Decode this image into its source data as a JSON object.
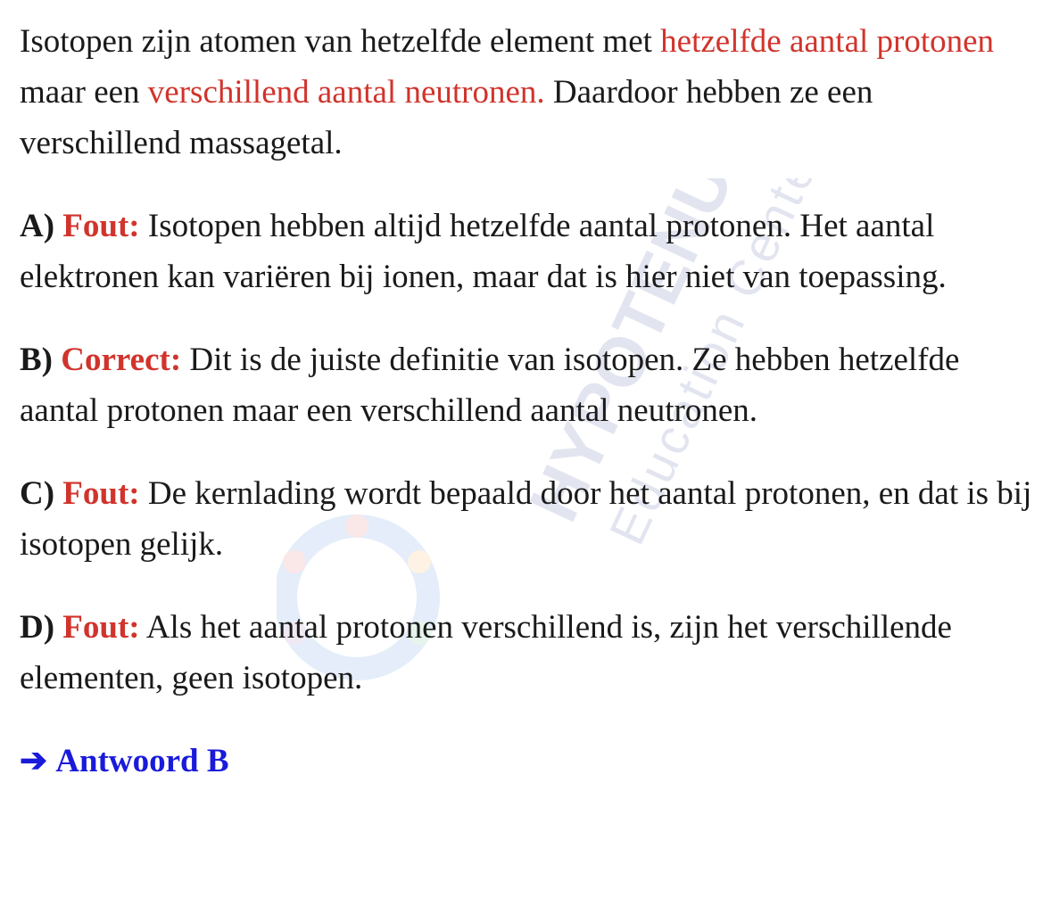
{
  "intro": {
    "part1": "Isotopen zijn atomen van hetzelfde element met ",
    "highlight1": "hetzelfde aantal protonen",
    "part2": " maar een ",
    "highlight2": "verschillend aantal neutronen.",
    "part3": " Daardoor hebben ze een verschillend massagetal."
  },
  "options": [
    {
      "letter": "A)",
      "verdict": "Fout:",
      "text": " Isotopen hebben altijd hetzelfde aantal protonen. Het aantal elektronen kan variëren bij ionen, maar dat is hier niet van toepassing."
    },
    {
      "letter": "B)",
      "verdict": "Correct:",
      "text": " Dit is de juiste definitie van isotopen. Ze hebben hetzelfde aantal protonen maar een verschillend aantal neutronen."
    },
    {
      "letter": "C)",
      "verdict": "Fout:",
      "text": " De kernlading wordt bepaald door het aantal protonen, en dat is bij isotopen gelijk."
    },
    {
      "letter": "D)",
      "verdict": "Fout:",
      "text": " Als het aantal protonen verschillend is, zijn het verschillende elementen, geen isotopen."
    }
  ],
  "answer": {
    "arrow": "➔",
    "label": "Antwoord B"
  },
  "watermark": {
    "brand": "HYPOTENUSE",
    "sub": "Education Center"
  },
  "colors": {
    "highlight": "#d0342c",
    "answer": "#1a1adb"
  }
}
